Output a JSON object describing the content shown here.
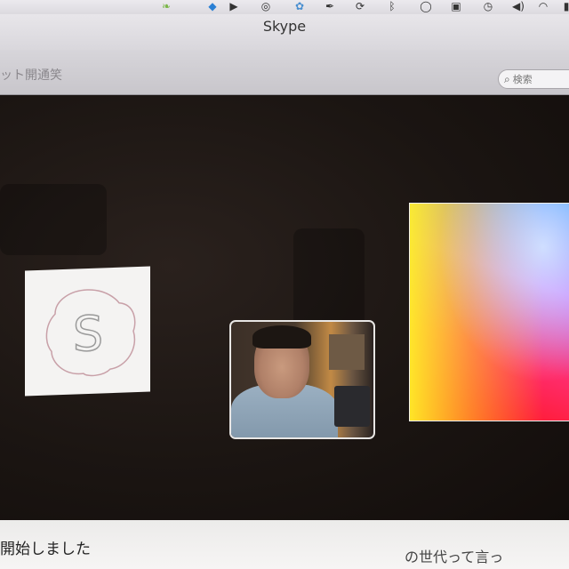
{
  "menubar": {
    "icons": [
      {
        "name": "evernote-icon",
        "glyph": "❧",
        "color": "#7ab648"
      },
      {
        "name": "dropbox-icon",
        "glyph": "◆",
        "color": "#2a7fd4"
      },
      {
        "name": "media-player-icon",
        "glyph": "▶",
        "color": "#333333"
      },
      {
        "name": "headphones-icon",
        "glyph": "◎",
        "color": "#333333"
      },
      {
        "name": "sync-app-icon",
        "glyph": "✿",
        "color": "#4a8fd0"
      },
      {
        "name": "pen-icon",
        "glyph": "✒",
        "color": "#333333"
      },
      {
        "name": "sync-icon",
        "glyph": "⟳",
        "color": "#333333"
      },
      {
        "name": "bluetooth-icon",
        "glyph": "ᛒ",
        "color": "#333333"
      },
      {
        "name": "chat-icon",
        "glyph": "◯",
        "color": "#333333"
      },
      {
        "name": "display-icon",
        "glyph": "▣",
        "color": "#333333"
      },
      {
        "name": "time-machine-icon",
        "glyph": "◷",
        "color": "#333333"
      },
      {
        "name": "volume-icon",
        "glyph": "◀)",
        "color": "#333333"
      },
      {
        "name": "wifi-icon",
        "glyph": "◠",
        "color": "#333333"
      },
      {
        "name": "battery-icon",
        "glyph": "▮",
        "color": "#333333"
      }
    ]
  },
  "window": {
    "title": "Skype"
  },
  "toolbar": {
    "partial_label": "ット開通笑",
    "search_placeholder": "検索"
  },
  "call": {
    "skype_logo_text": "S"
  },
  "chat": {
    "left_text": "開始しました",
    "right_text": "の世代って言っ"
  }
}
